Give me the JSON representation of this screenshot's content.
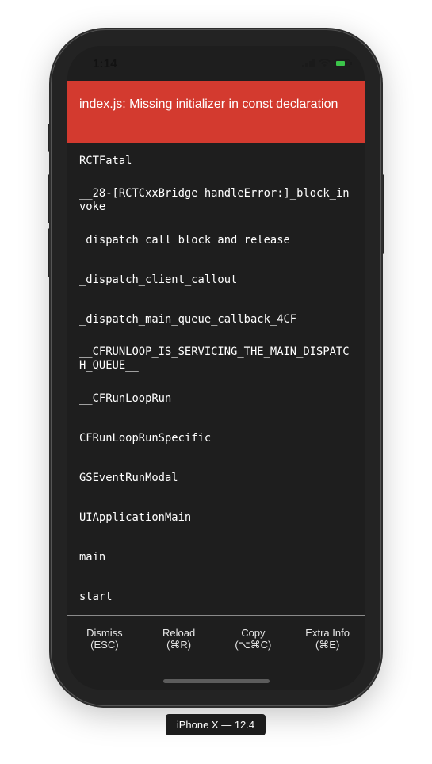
{
  "status_bar": {
    "time": "1:14",
    "icons": [
      "cellular-signal-icon",
      "wifi-icon",
      "battery-charging-icon"
    ]
  },
  "error": {
    "message": "index.js: Missing initializer in const declaration",
    "background_color": "#d33a2f"
  },
  "stack_frames": [
    "RCTFatal",
    "__28-[RCTCxxBridge handleError:]_block_invoke",
    "_dispatch_call_block_and_release",
    "_dispatch_client_callout",
    "_dispatch_main_queue_callback_4CF",
    "__CFRUNLOOP_IS_SERVICING_THE_MAIN_DISPATCH_QUEUE__",
    "__CFRunLoopRun",
    "CFRunLoopRunSpecific",
    "GSEventRunModal",
    "UIApplicationMain",
    "main",
    "start"
  ],
  "toolbar": {
    "dismiss": {
      "label": "Dismiss",
      "shortcut": "(ESC)"
    },
    "reload": {
      "label": "Reload",
      "shortcut": "(⌘R)"
    },
    "copy": {
      "label": "Copy",
      "shortcut": "(⌥⌘C)"
    },
    "extra_info": {
      "label": "Extra Info",
      "shortcut": "(⌘E)"
    }
  },
  "simulator": {
    "device_label": "iPhone X — 12.4"
  }
}
